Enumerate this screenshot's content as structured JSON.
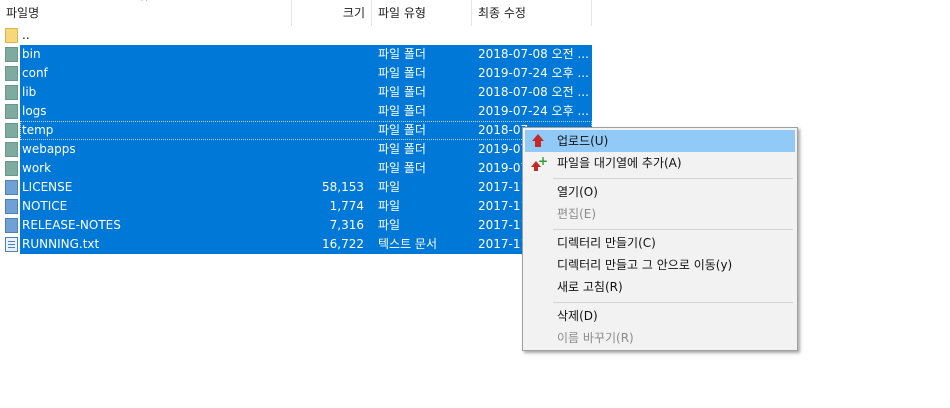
{
  "header": {
    "name": "파일명",
    "size": "크기",
    "type": "파일 유형",
    "modified": "최종 수정",
    "sort_arrow": "^"
  },
  "files": [
    {
      "name": "..",
      "size": "",
      "type": "",
      "modified": "",
      "icon": "parent-folder-icon",
      "selected": false
    },
    {
      "name": "bin",
      "size": "",
      "type": "파일 폴더",
      "modified": "2018-07-08 오전 ...",
      "icon": "folder-icon",
      "selected": true
    },
    {
      "name": "conf",
      "size": "",
      "type": "파일 폴더",
      "modified": "2019-07-24 오후 ...",
      "icon": "folder-icon",
      "selected": true
    },
    {
      "name": "lib",
      "size": "",
      "type": "파일 폴더",
      "modified": "2018-07-08 오전 ...",
      "icon": "folder-icon",
      "selected": true
    },
    {
      "name": "logs",
      "size": "",
      "type": "파일 폴더",
      "modified": "2019-07-24 오후 ...",
      "icon": "folder-icon",
      "selected": true
    },
    {
      "name": "temp",
      "size": "",
      "type": "파일 폴더",
      "modified": "2018-07",
      "icon": "folder-icon",
      "selected": true
    },
    {
      "name": "webapps",
      "size": "",
      "type": "파일 폴더",
      "modified": "2019-07",
      "icon": "folder-icon",
      "selected": true
    },
    {
      "name": "work",
      "size": "",
      "type": "파일 폴더",
      "modified": "2019-07",
      "icon": "folder-icon",
      "selected": true
    },
    {
      "name": "LICENSE",
      "size": "58,153",
      "type": "파일",
      "modified": "2017-11",
      "icon": "file-icon",
      "selected": true
    },
    {
      "name": "NOTICE",
      "size": "1,774",
      "type": "파일",
      "modified": "2017-11",
      "icon": "file-icon",
      "selected": true
    },
    {
      "name": "RELEASE-NOTES",
      "size": "7,316",
      "type": "파일",
      "modified": "2017-11",
      "icon": "file-icon",
      "selected": true
    },
    {
      "name": "RUNNING.txt",
      "size": "16,722",
      "type": "텍스트 문서",
      "modified": "2017-11",
      "icon": "text-file-icon",
      "selected": true
    }
  ],
  "context_menu": {
    "upload": "업로드(U)",
    "add_to_queue": "파일을 대기열에 추가(A)",
    "open": "열기(O)",
    "edit": "편집(E)",
    "create_dir": "디렉터리 만들기(C)",
    "create_dir_enter": "디렉터리 만들고 그 안으로 이동(y)",
    "refresh": "새로 고침(R)",
    "delete": "삭제(D)",
    "rename": "이름 바꾸기(R)"
  },
  "colors": {
    "selection": "#0078d7",
    "menu_highlight": "#91c9f7",
    "menu_background": "#f2f2f2"
  }
}
